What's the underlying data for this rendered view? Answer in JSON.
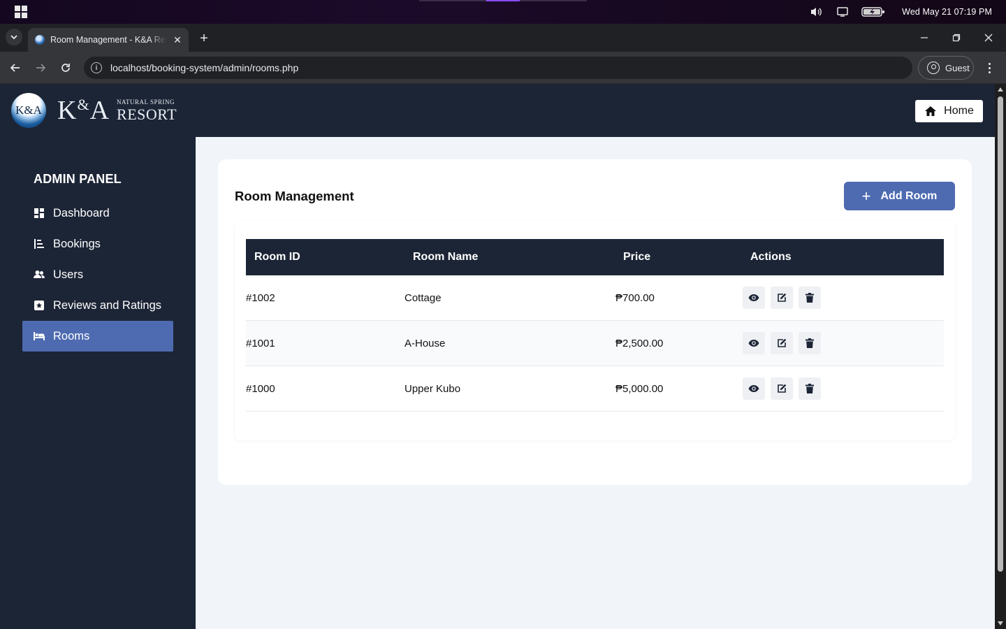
{
  "os": {
    "clock": "Wed May 21  07:19 PM"
  },
  "browser": {
    "tab_title": "Room Management - K&A Resort",
    "url": "localhost/booking-system/admin/rooms.php",
    "profile_label": "Guest"
  },
  "header": {
    "logo_badge": "K&A",
    "logo_word": "K",
    "logo_amp": "&",
    "logo_word2": "A",
    "logo_tagline": "NATURAL SPRING",
    "logo_resort": "RESORT",
    "home_label": "Home"
  },
  "sidebar": {
    "title": "ADMIN PANEL",
    "items": [
      {
        "label": "Dashboard",
        "icon": "dashboard-icon"
      },
      {
        "label": "Bookings",
        "icon": "list-icon"
      },
      {
        "label": "Users",
        "icon": "users-icon"
      },
      {
        "label": "Reviews and Ratings",
        "icon": "star-icon"
      },
      {
        "label": "Rooms",
        "icon": "bed-icon",
        "active": true
      }
    ]
  },
  "main": {
    "title": "Room Management",
    "add_label": "Add Room",
    "columns": [
      "Room ID",
      "Room Name",
      "Price",
      "Actions"
    ],
    "rows": [
      {
        "id": "#1002",
        "name": "Cottage",
        "price": "₱700.00"
      },
      {
        "id": "#1001",
        "name": "A-House",
        "price": "₱2,500.00"
      },
      {
        "id": "#1000",
        "name": "Upper Kubo",
        "price": "₱5,000.00"
      }
    ]
  },
  "colors": {
    "navy": "#1c2536",
    "accent": "#4e6bb1",
    "page_bg": "#f1f5f9"
  }
}
